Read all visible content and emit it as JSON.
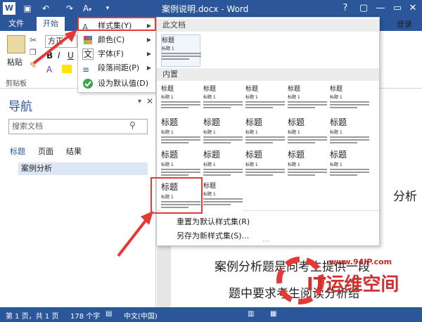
{
  "window": {
    "title": "案例说明.docx - Word",
    "help": "?",
    "minimize": "—",
    "restore": "▭",
    "close": "✕"
  },
  "ribbon": {
    "file_tab": "文件",
    "home_tab": "开始",
    "login": "登录",
    "paste": "粘贴",
    "clipboard_group": "剪贴板",
    "font_name": "方正"
  },
  "menu": {
    "items": [
      {
        "label": "样式集(Y)",
        "icon": "style-set-icon"
      },
      {
        "label": "颜色(C)",
        "icon": "color-icon"
      },
      {
        "label": "字体(F)",
        "icon": "font-icon"
      },
      {
        "label": "段落间距(P)",
        "icon": "paragraph-spacing-icon"
      },
      {
        "label": "设为默认值(D)",
        "icon": "check-default-icon"
      }
    ]
  },
  "gallery": {
    "this_doc": "此文档",
    "builtin": "内置",
    "thumb_heading": "标题",
    "thumb_heading1": "标题 1",
    "reset": "重置为默认样式集(R)",
    "save_new": "另存为新样式集(S)..."
  },
  "nav": {
    "title": "导航",
    "search_placeholder": "搜索文档",
    "tabs": [
      "标题",
      "页面",
      "结果"
    ],
    "heading_item": "案例分析"
  },
  "document": {
    "line1_partial": "分析",
    "line2": "案例分析题是向考生提供一段",
    "line3": "题中要求考生阅读分析给"
  },
  "status": {
    "page": "第 1 页，共 1 页",
    "words": "178 个字",
    "lang": "中文(中国)"
  },
  "watermark": {
    "url": "www.94IP.com",
    "brand": "IT运维空间"
  }
}
